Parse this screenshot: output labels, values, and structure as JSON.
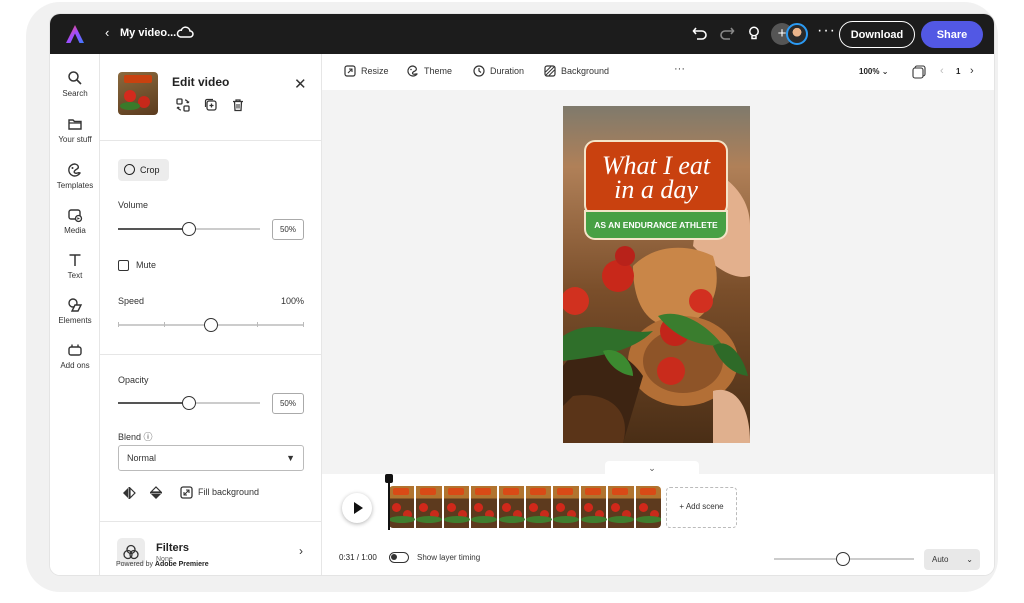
{
  "header": {
    "back_glyph": "‹",
    "doc_title": "My video...",
    "download_label": "Download",
    "share_label": "Share",
    "add_glyph": "+",
    "more_glyph": "···"
  },
  "rail": {
    "items": [
      {
        "label": "Search",
        "icon": "search-icon"
      },
      {
        "label": "Your stuff",
        "icon": "folder-icon"
      },
      {
        "label": "Templates",
        "icon": "templates-icon"
      },
      {
        "label": "Media",
        "icon": "media-icon"
      },
      {
        "label": "Text",
        "icon": "text-icon"
      },
      {
        "label": "Elements",
        "icon": "elements-icon"
      },
      {
        "label": "Add ons",
        "icon": "addons-icon"
      }
    ]
  },
  "panel": {
    "title": "Edit video",
    "close_glyph": "✕",
    "crop_label": "Crop",
    "volume_label": "Volume",
    "volume_value": "50%",
    "volume_level": 0.5,
    "mute_label": "Mute",
    "speed_label": "Speed",
    "speed_value": "100%",
    "speed_level": 0.5,
    "opacity_label": "Opacity",
    "opacity_value": "50%",
    "opacity_level": 0.5,
    "blend_label": "Blend",
    "blend_info_glyph": "ⓘ",
    "blend_value": "Normal",
    "fill_background_label": "Fill background",
    "filters_title": "Filters",
    "filters_value": "None",
    "powered_prefix": "Powered by ",
    "powered_brand": "Adobe Premiere"
  },
  "toolbar": {
    "resize_label": "Resize",
    "theme_label": "Theme",
    "duration_label": "Duration",
    "background_label": "Background",
    "more_glyph": "···",
    "zoom_value": "100%",
    "page_number": "1"
  },
  "video": {
    "title_line1": "What I eat",
    "title_line2": "in a day",
    "subtitle": "AS AN ENDURANCE ATHLETE",
    "title_bg": "#c9410f",
    "subtitle_bg": "#47a044"
  },
  "timeline": {
    "add_scene_label": "+ Add scene",
    "time_readout": "0:31 / 1:00",
    "show_layer_timing_label": "Show layer timing",
    "auto_label": "Auto",
    "clip_label": "What I eat"
  },
  "colors": {
    "topbar": "#1c1c1c",
    "share": "#5258e4"
  }
}
